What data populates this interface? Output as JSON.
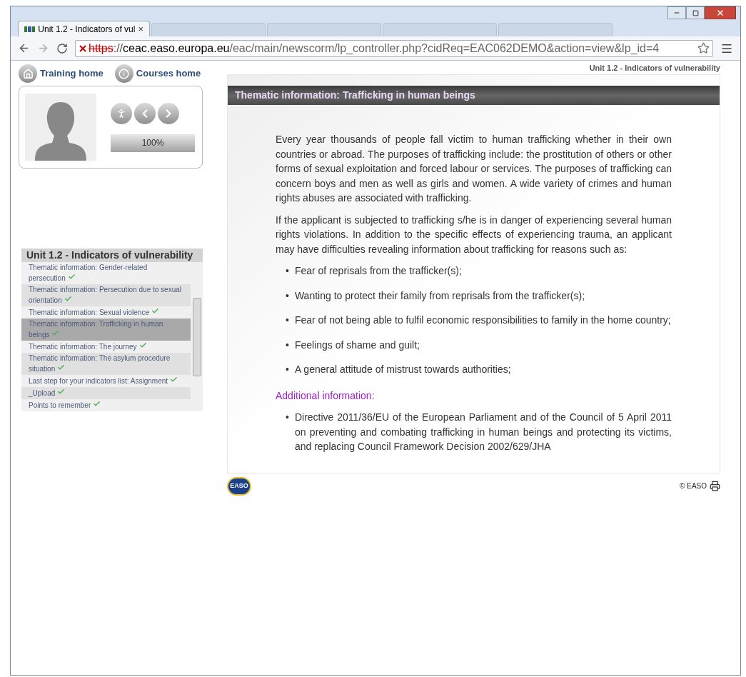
{
  "browser": {
    "tabs": [
      {
        "title": "Unit 1.2 - Indicators of vul",
        "selected": true
      },
      {
        "selected": false
      },
      {
        "selected": false
      },
      {
        "selected": false
      },
      {
        "selected": false
      }
    ],
    "close_label": "×",
    "address": {
      "scheme": "https",
      "separator": "://",
      "host": "ceac.easo.europa.eu",
      "path": "/eac/main/newscorm/lp_controller.php?cidReq=EAC062DEMO&action=view&lp_id=4"
    }
  },
  "nav": [
    {
      "kind": "home",
      "label": "Training home"
    },
    {
      "kind": "info",
      "label": "Courses home"
    }
  ],
  "progress": {
    "level": 1,
    "reading": "100%"
  },
  "toc": {
    "title": "Unit 1.2 - Indicators of vulnerability",
    "items": [
      {
        "label": "Thematic information: Gender-related persecution",
        "done": true,
        "selected": false
      },
      {
        "label": "Thematic information: Persecution due to sexual orientation",
        "done": true,
        "selected": false
      },
      {
        "label": "Thematic information: Sexual violence",
        "done": true,
        "selected": false
      },
      {
        "label": "Thematic information: Trafficking in human beings",
        "done": true,
        "selected": true
      },
      {
        "label": "Thematic information: The journey",
        "done": true,
        "selected": false
      },
      {
        "label": "Thematic information: The asylum procedure situation",
        "done": true,
        "selected": false
      },
      {
        "label": "Last step for your indicators list: Assignment",
        "done": true,
        "selected": false
      },
      {
        "label": "_Upload",
        "done": true,
        "selected": false
      },
      {
        "label": "Points to remember",
        "done": true,
        "selected": false
      }
    ]
  },
  "content": {
    "breadcrumb": "Unit 1.2 - Indicators of vulnerability",
    "heading": "Thematic information: Trafficking in human beings",
    "paragraphs": [
      "Every year thousands of people fall victim to human trafficking whether in their own countries or abroad. The purposes of trafficking include: the prostitution of others or other forms of sexual exploitation and forced labour or services. The purposes of trafficking can concern boys and men as well as girls and women. A wide variety of crimes and human rights abuses are associated with trafficking.",
      "If the applicant is subjected to trafficking s/he is in danger of experiencing several human rights violations. In addition to the specific effects of experiencing trauma, an applicant may have difficulties revealing information about trafficking for reasons such as:"
    ],
    "marker": "•",
    "bullets": [
      "Fear of reprisals from the trafficker(s);",
      "Wanting to protect their family from reprisals from the trafficker(s);",
      "Fear of not being able to fulfil economic responsibilities to family in the home country;",
      "Feelings of shame and guilt;",
      "A general attitude of mistrust towards authorities;"
    ],
    "additional_heading": "Additional information:",
    "additional_bullets": [
      "Directive 2011/36/EU of the European Parliament and of the Council of 5 April 2011 on preventing and combating trafficking in human beings and protecting its victims, and replacing Council Framework Decision 2002/629/JHA"
    ],
    "logo_text": "EASO",
    "copyright": "© EASO"
  }
}
